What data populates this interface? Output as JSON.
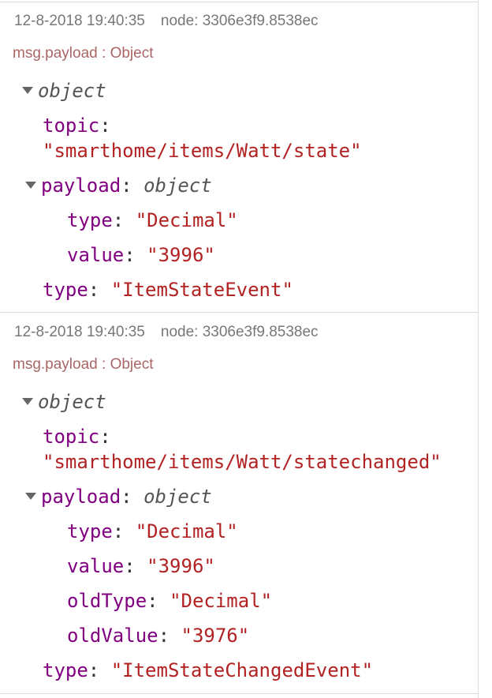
{
  "messages": [
    {
      "timestamp": "12-8-2018 19:40:35",
      "node": "node: 3306e3f9.8538ec",
      "topic_label": "msg.payload : Object",
      "root_type": "object",
      "topic_key": "topic",
      "topic_value": "\"smarthome/items/Watt/state\"",
      "payload_key": "payload",
      "payload_type": "object",
      "payload_fields": [
        {
          "key": "type",
          "value": "\"Decimal\""
        },
        {
          "key": "value",
          "value": "\"3996\""
        }
      ],
      "type_key": "type",
      "type_value": "\"ItemStateEvent\""
    },
    {
      "timestamp": "12-8-2018 19:40:35",
      "node": "node: 3306e3f9.8538ec",
      "topic_label": "msg.payload : Object",
      "root_type": "object",
      "topic_key": "topic",
      "topic_value": "\"smarthome/items/Watt/statechanged\"",
      "payload_key": "payload",
      "payload_type": "object",
      "payload_fields": [
        {
          "key": "type",
          "value": "\"Decimal\""
        },
        {
          "key": "value",
          "value": "\"3996\""
        },
        {
          "key": "oldType",
          "value": "\"Decimal\""
        },
        {
          "key": "oldValue",
          "value": "\"3976\""
        }
      ],
      "type_key": "type",
      "type_value": "\"ItemStateChangedEvent\""
    }
  ]
}
